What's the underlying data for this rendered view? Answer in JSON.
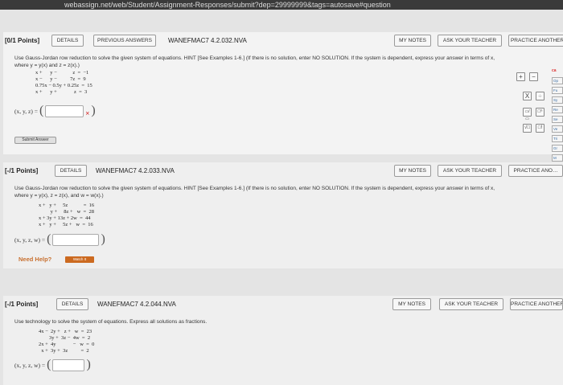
{
  "browser_bar": "webassign.net/web/Student/Assignment-Responses/submit?dep=29999999&tags=autosave#question",
  "q1": {
    "points": "[0/1 Points]",
    "details": "DETAILS",
    "previous": "PREVIOUS ANSWERS",
    "id": "WANEFMAC7 4.2.032.NVA",
    "my_notes": "MY NOTES",
    "ask": "ASK YOUR TEACHER",
    "practice": "PRACTICE ANOTHER",
    "instruction1": "Use Gauss-Jordan row reduction to solve the given system of equations. HINT [See Examples 1-6.] (If there is no solution, enter NO SOLUTION. If the system is dependent, express your answer in terms of x,",
    "instruction2": "where y = y(x) and z = z(x).)",
    "eq1": "x +      y −            z  =  −1",
    "eq2": "x −      y −          7z  =  9",
    "eq3": "0.75x − 0.5y + 0.25z  =  15",
    "eq4": "x +      y +             z  =  3",
    "answer_label": "(x, y, z) =",
    "wrong_mark": "×",
    "submit": "Submit Answer"
  },
  "toolbar": {
    "row1": [
      "+",
      "−"
    ],
    "row2": [
      "X",
      "÷"
    ],
    "row3": [
      "▭/▭",
      "□ⁿ"
    ],
    "row4": [
      "√□",
      "□!"
    ]
  },
  "side_panel": {
    "header": "ca",
    "items": [
      "Op",
      "Fu",
      "Sy",
      "Re",
      "Se",
      "Ve",
      "Tri",
      "Gr",
      "M"
    ]
  },
  "q2": {
    "points": "[-/1 Points]",
    "details": "DETAILS",
    "id": "WANEFMAC7 4.2.033.NVA",
    "my_notes": "MY NOTES",
    "ask": "ASK YOUR TEACHER",
    "practice": "PRACTICE ANO…",
    "instruction1": "Use Gauss-Jordan row reduction to solve the given system of equations. HINT [See Examples 1-6.] (If there is no solution, enter NO SOLUTION. If the system is dependent, express your answer in terms of x,",
    "instruction2": "where y = y(x), z = z(x), and w = w(x).)",
    "eq1": "x +   y +     5z            =  16",
    "eq2": "         y +     8z +   w  =  28",
    "eq3": "x + 3y + 13z + 2w  =  44",
    "eq4": "x +   y +     5z +   w  =  16",
    "answer_label": "(x, y, z, w) =",
    "need_help": "Need Help?",
    "watch": "Watch It"
  },
  "q3": {
    "points": "[-/1 Points]",
    "details": "DETAILS",
    "id": "WANEFMAC7 4.2.044.NVA",
    "my_notes": "MY NOTES",
    "ask": "ASK YOUR TEACHER",
    "practice": "PRACTICE ANOTHER",
    "instruction1": "Use technology to solve the system of equations. Express all solutions as fractions.",
    "eq1": "4x −  2y +   z +   w  =  23",
    "eq2": "        3y +  3z −  4w  =  2",
    "eq3": "2x +  4y             −   w  =  0",
    "eq4": "  x +  3y +  3z          =  2",
    "answer_label": "(x, y, z, w) ="
  }
}
